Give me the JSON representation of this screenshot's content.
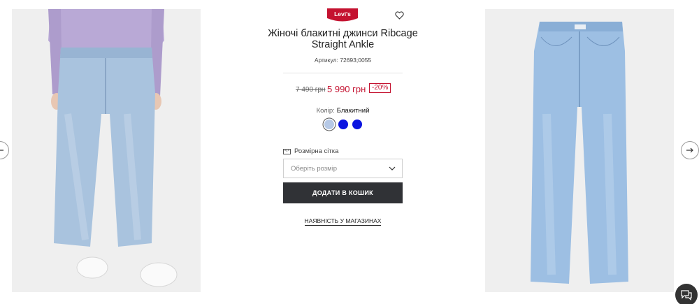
{
  "brand": {
    "logo_text": "Levi's",
    "logo_color": "#c41230"
  },
  "product": {
    "title": "Жіночі блакитні джинси Ribcage Straight Ankle",
    "sku_label": "Артикул: 72693;0055",
    "price_old": "7 490 грн",
    "price_new": "5 990 грн",
    "discount": "-20%"
  },
  "color": {
    "label": "Колір:",
    "value": "Блакитний",
    "swatches": [
      {
        "name": "light-blue",
        "hex": "#b6c9e6",
        "selected": true
      },
      {
        "name": "blue",
        "hex": "#0b14e0",
        "selected": false
      },
      {
        "name": "blue-2",
        "hex": "#0b14e0",
        "selected": false
      }
    ]
  },
  "size": {
    "guide_label": "Розмірна сітка",
    "placeholder": "Оберіть розмір"
  },
  "actions": {
    "add_to_cart": "ДОДАТИ В КОШИК",
    "store_availability": "НАЯВНІСТЬ У МАГАЗИНАХ"
  },
  "icons": {
    "wishlist": "heart-icon",
    "prev": "arrow-left-icon",
    "next": "arrow-right-icon",
    "size_guide": "ruler-icon",
    "dropdown": "chevron-down-icon",
    "chat": "chat-icon"
  },
  "colors": {
    "accent": "#c41230",
    "button_bg": "#303236",
    "photo_bg": "#efefef"
  }
}
